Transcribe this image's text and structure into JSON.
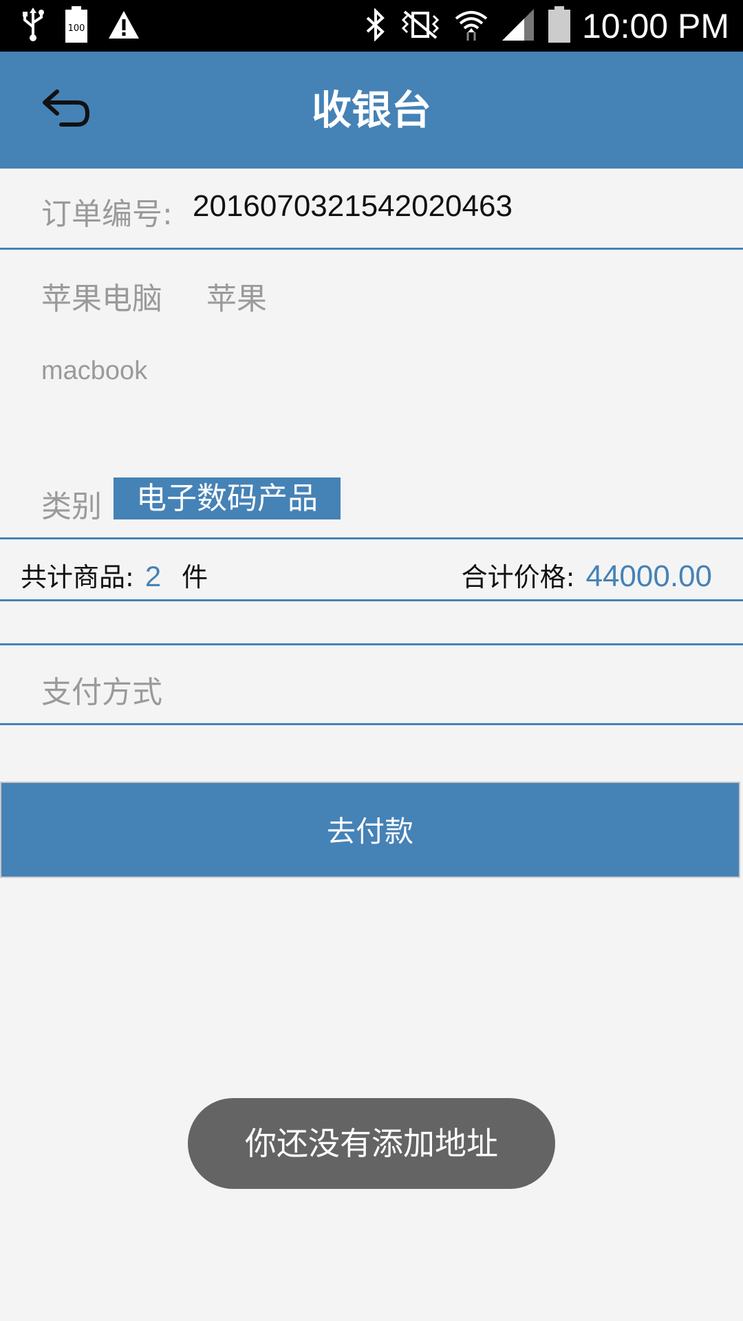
{
  "status_bar": {
    "time": "10:00 PM",
    "battery_level_text": "100",
    "icons": [
      "usb-icon",
      "battery-full-icon",
      "warning-icon",
      "bluetooth-icon",
      "vibrate-icon",
      "wifi-icon",
      "signal-icon",
      "battery-icon"
    ]
  },
  "app_bar": {
    "title": "收银台",
    "back_icon": "back-arrow-icon"
  },
  "order": {
    "label": "订单编号:",
    "number": "2016070321542020463"
  },
  "product": {
    "name": "苹果电脑",
    "brand": "苹果",
    "model": "macbook",
    "category_label": "类别",
    "category": "电子数码产品"
  },
  "summary": {
    "count_label": "共计商品:",
    "count": "2",
    "count_unit": "件",
    "total_label": "合计价格:",
    "total": "44000.00"
  },
  "payment": {
    "method_label": "支付方式",
    "pay_button": "去付款"
  },
  "toast": {
    "message": "你还没有添加地址"
  },
  "colors": {
    "accent": "#4582b6",
    "background": "#f4f4f4",
    "toast": "#646464"
  }
}
